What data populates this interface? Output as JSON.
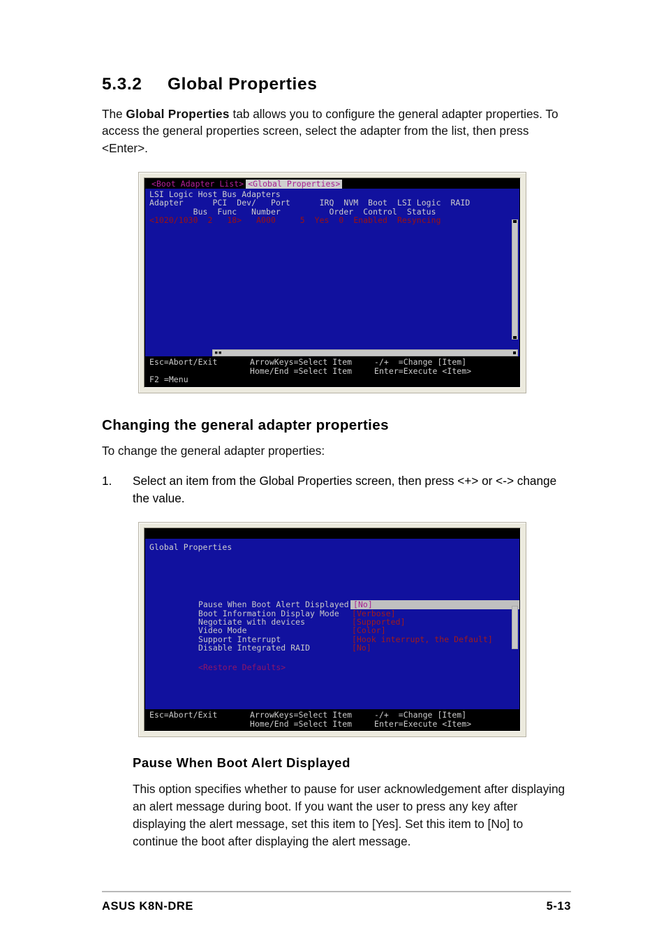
{
  "section": {
    "number": "5.3.2",
    "title": "Global Properties",
    "intro_pre": "The ",
    "intro_bold": "Global Properties",
    "intro_post": " tab allows you to configure the general adapter properties. To access the general properties screen, select the adapter from the list, then press <Enter>."
  },
  "screen1": {
    "tabs": [
      {
        "label": "<Boot Adapter List>",
        "active": false
      },
      {
        "label": "<Global Properties>",
        "active": true
      }
    ],
    "title_line": "LSI Logic Host Bus Adapters",
    "table": {
      "header_row1": [
        "Adapter",
        "PCI",
        "Dev/",
        "Port",
        "IRQ",
        "NVM",
        "Boot",
        "LSI Logic",
        "RAID"
      ],
      "header_row2": [
        "",
        "Bus",
        "Func",
        "Number",
        "",
        "",
        "Order",
        "Control",
        "Status"
      ],
      "rows": [
        [
          "<1020/1030",
          "2",
          "18>",
          "A000",
          "5",
          "Yes",
          "0",
          "Enabled",
          "Resyncing"
        ]
      ]
    },
    "hscroll_marks": "▪▪",
    "keys": {
      "line1": [
        "Esc=Abort/Exit",
        "ArrowKeys=Select Item",
        "-/+  =Change [Item]"
      ],
      "line2": [
        "",
        "Home/End =Select Item",
        "Enter=Execute <Item>"
      ],
      "line3": [
        "F2 =Menu",
        "",
        ""
      ]
    }
  },
  "heading_changing": "Changing the general adapter properties",
  "lead_changing": "To change the general adapter properties:",
  "step1": {
    "marker": "1.",
    "text": "Select an item from the Global Properties screen, then press <+> or <-> change the value."
  },
  "screen2": {
    "title": "Global Properties",
    "settings": [
      {
        "label": "Pause When Boot Alert Displayed",
        "value": "[No]",
        "selected": true
      },
      {
        "label": "Boot Information Display Mode",
        "value": "[Verbose]",
        "selected": false
      },
      {
        "label": "Negotiate with devices",
        "value": "[Supported]",
        "selected": false
      },
      {
        "label": "Video Mode",
        "value": "[Color]",
        "selected": false
      },
      {
        "label": "Support Interrupt",
        "value": "[Hook interrupt, the Default]",
        "selected": false
      },
      {
        "label": "Disable Integrated RAID",
        "value": "[No]",
        "selected": false
      }
    ],
    "restore": "<Restore Defaults>",
    "keys": {
      "line1": [
        "Esc=Abort/Exit",
        "ArrowKeys=Select Item",
        "-/+  =Change [Item]"
      ],
      "line2": [
        "",
        "Home/End =Select Item",
        "Enter=Execute <Item>"
      ]
    }
  },
  "option_doc": {
    "name": "Pause When Boot Alert Displayed",
    "body": "This option specifies whether to pause for user acknowledgement after displaying an alert message during boot. If you want the user to press any key after displaying the alert message, set this item to [Yes]. Set this item to [No] to continue the boot after displaying the alert message."
  },
  "footer": {
    "left": "ASUS K8N-DRE",
    "right": "5-13"
  },
  "colors": {
    "bios_blue": "#11119e",
    "bios_black": "#000000",
    "tab_magenta": "#b5219b",
    "data_red": "#9d1010",
    "scrollbar_grey": "#c7c7c7",
    "frame_beige": "#eceade"
  }
}
